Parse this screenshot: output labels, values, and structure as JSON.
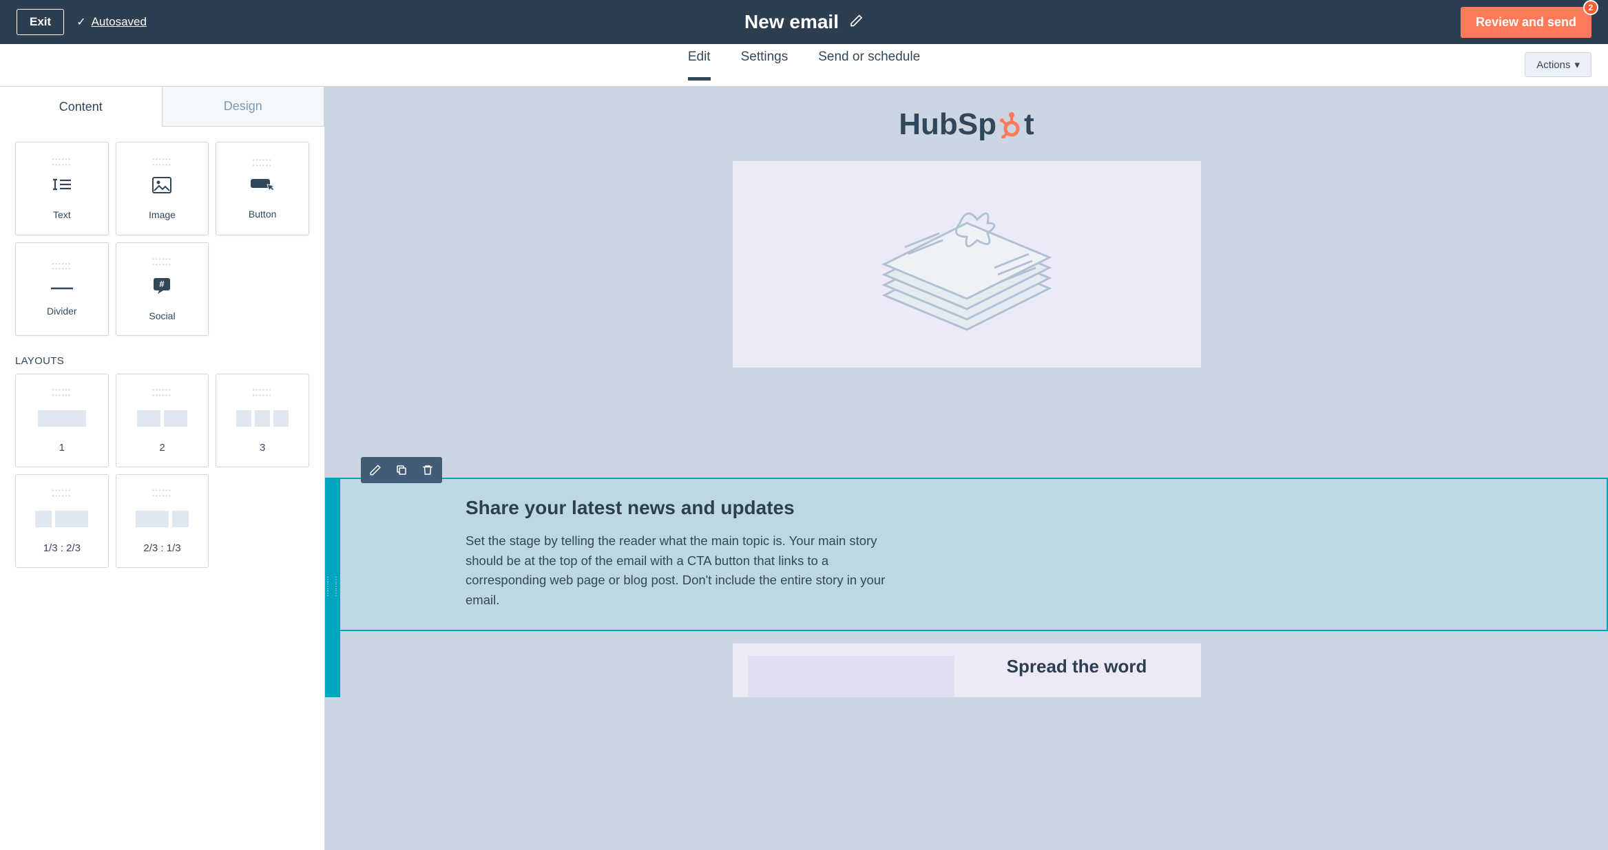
{
  "topbar": {
    "exit": "Exit",
    "autosaved": "Autosaved",
    "title": "New email",
    "review": "Review and send",
    "review_badge": "2"
  },
  "nav": {
    "tabs": {
      "edit": "Edit",
      "settings": "Settings",
      "send": "Send or schedule"
    },
    "actions": "Actions"
  },
  "sidebar": {
    "tabs": {
      "content": "Content",
      "design": "Design"
    },
    "blocks": {
      "text": "Text",
      "image": "Image",
      "button": "Button",
      "divider": "Divider",
      "social": "Social"
    },
    "layouts_heading": "LAYOUTS",
    "layouts": {
      "l1": "1",
      "l2": "2",
      "l3": "3",
      "l4": "1/3 : 2/3",
      "l5": "2/3 : 1/3"
    }
  },
  "canvas": {
    "logo_text_1": "HubSp",
    "logo_text_2": "t",
    "selected": {
      "heading": "Share your latest news and updates",
      "body": "Set the stage by telling the reader what the main topic is. Your main story should be at the top of the email with a CTA button that links to a corresponding web page or blog post. Don't include the entire story in your email."
    },
    "spread": {
      "heading": "Spread the word"
    }
  }
}
